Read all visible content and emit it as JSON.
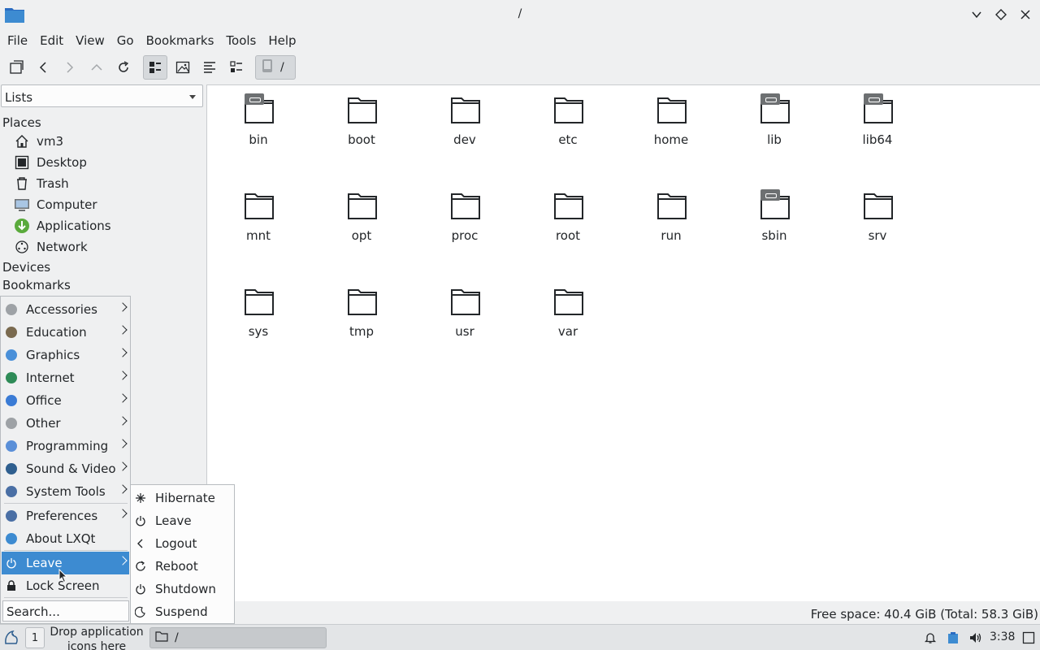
{
  "window": {
    "title": "/"
  },
  "menubar": [
    "File",
    "Edit",
    "View",
    "Go",
    "Bookmarks",
    "Tools",
    "Help"
  ],
  "toolbar": {
    "path_label": "/"
  },
  "sidebar": {
    "mode": "Lists",
    "places_header": "Places",
    "places": [
      {
        "label": "vm3",
        "icon": "home-icon"
      },
      {
        "label": "Desktop",
        "icon": "desktop-icon"
      },
      {
        "label": "Trash",
        "icon": "trash-icon"
      },
      {
        "label": "Computer",
        "icon": "computer-icon"
      },
      {
        "label": "Applications",
        "icon": "applications-icon"
      },
      {
        "label": "Network",
        "icon": "network-icon"
      }
    ],
    "devices_header": "Devices",
    "bookmarks_header": "Bookmarks"
  },
  "files": [
    {
      "name": "bin",
      "link": true
    },
    {
      "name": "boot",
      "link": false
    },
    {
      "name": "dev",
      "link": false
    },
    {
      "name": "etc",
      "link": false
    },
    {
      "name": "home",
      "link": false
    },
    {
      "name": "lib",
      "link": true
    },
    {
      "name": "lib64",
      "link": true
    },
    {
      "name": "mnt",
      "link": false
    },
    {
      "name": "opt",
      "link": false
    },
    {
      "name": "proc",
      "link": false
    },
    {
      "name": "root",
      "link": false
    },
    {
      "name": "run",
      "link": false
    },
    {
      "name": "sbin",
      "link": true
    },
    {
      "name": "srv",
      "link": false
    },
    {
      "name": "sys",
      "link": false
    },
    {
      "name": "tmp",
      "link": false
    },
    {
      "name": "usr",
      "link": false
    },
    {
      "name": "var",
      "link": false
    }
  ],
  "statusbar": {
    "text": "Free space: 40.4 GiB (Total: 58.3 GiB)"
  },
  "start_menu": {
    "items": [
      {
        "label": "Accessories",
        "color": "#9ea2a6",
        "submenu": true
      },
      {
        "label": "Education",
        "color": "#7a6a4f",
        "submenu": true
      },
      {
        "label": "Graphics",
        "color": "#4a90d9",
        "submenu": true
      },
      {
        "label": "Internet",
        "color": "#2e8b57",
        "submenu": true
      },
      {
        "label": "Office",
        "color": "#3a7bd5",
        "submenu": true
      },
      {
        "label": "Other",
        "color": "#9ea2a6",
        "submenu": true
      },
      {
        "label": "Programming",
        "color": "#5a8fd8",
        "submenu": true
      },
      {
        "label": "Sound & Video",
        "color": "#2f5f8f",
        "submenu": true
      },
      {
        "label": "System Tools",
        "color": "#4a6fa5",
        "submenu": true
      },
      {
        "label": "Preferences",
        "color": "#4a6fa5",
        "submenu": true
      },
      {
        "label": "About LXQt",
        "color": "#3d8bd1",
        "submenu": false
      },
      {
        "label": "Leave",
        "color": "#ffffff",
        "submenu": true
      },
      {
        "label": "Lock Screen",
        "color": "#232629",
        "submenu": false
      }
    ],
    "search_placeholder": "Search..."
  },
  "leave_menu": [
    "Hibernate",
    "Leave",
    "Logout",
    "Reboot",
    "Shutdown",
    "Suspend"
  ],
  "panel": {
    "desktop_number": "1",
    "quicklaunch_text": "Drop application icons here",
    "task_label": "/",
    "clock": "3:38"
  }
}
